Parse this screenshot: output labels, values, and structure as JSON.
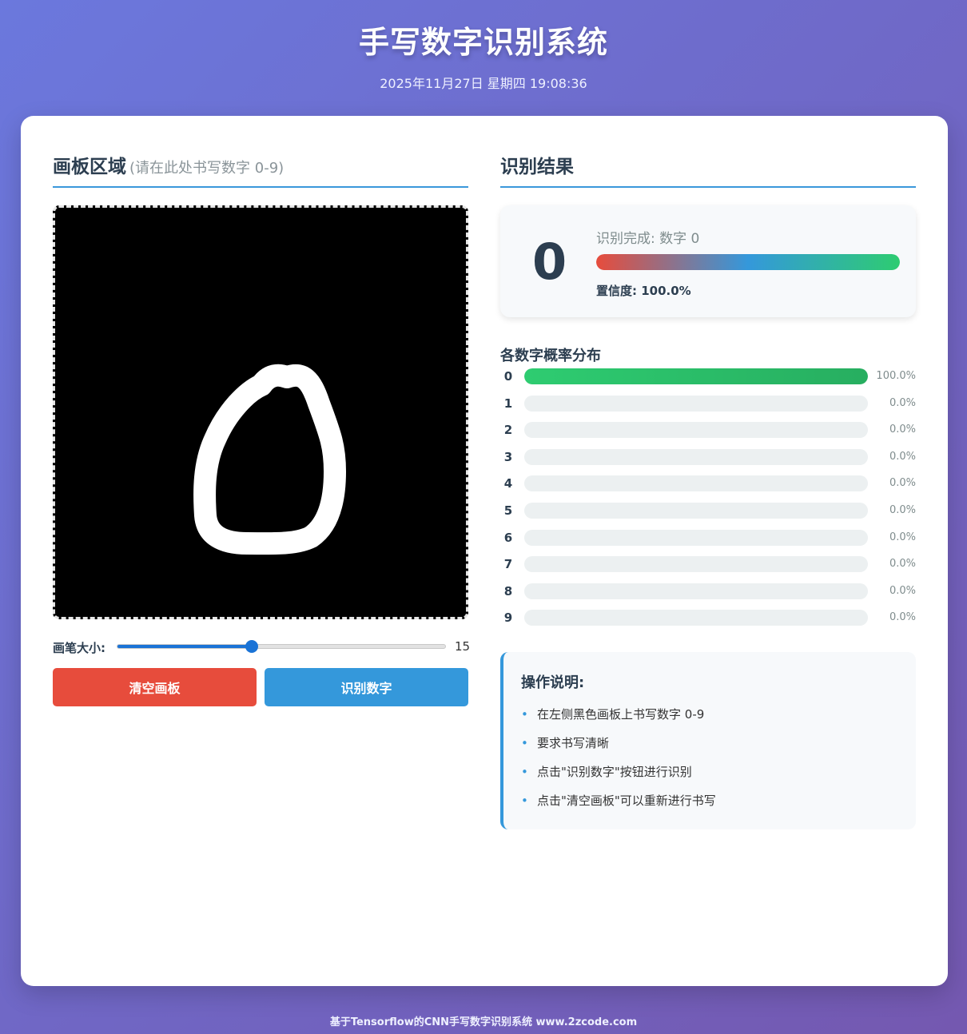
{
  "header": {
    "title": "手写数字识别系统",
    "datetime": "2025年11月27日 星期四 19:08:36"
  },
  "canvas_section": {
    "title": "画板区域",
    "hint": "(请在此处书写数字 0-9)",
    "brush_label": "画笔大小:",
    "brush_value": "15",
    "brush_fraction": 0.41,
    "clear_label": "清空画板",
    "recognize_label": "识别数字"
  },
  "result_section": {
    "title": "识别结果",
    "digit": "0",
    "status": "识别完成: 数字 0",
    "confidence_text": "置信度: 100.0%",
    "confidence_fraction": 1.0
  },
  "probability": {
    "title": "各数字概率分布",
    "rows": [
      {
        "digit": "0",
        "value": "100.0%",
        "fraction": 1.0
      },
      {
        "digit": "1",
        "value": "0.0%",
        "fraction": 0
      },
      {
        "digit": "2",
        "value": "0.0%",
        "fraction": 0
      },
      {
        "digit": "3",
        "value": "0.0%",
        "fraction": 0
      },
      {
        "digit": "4",
        "value": "0.0%",
        "fraction": 0
      },
      {
        "digit": "5",
        "value": "0.0%",
        "fraction": 0
      },
      {
        "digit": "6",
        "value": "0.0%",
        "fraction": 0
      },
      {
        "digit": "7",
        "value": "0.0%",
        "fraction": 0
      },
      {
        "digit": "8",
        "value": "0.0%",
        "fraction": 0
      },
      {
        "digit": "9",
        "value": "0.0%",
        "fraction": 0
      }
    ]
  },
  "instructions": {
    "title": "操作说明:",
    "items": [
      "在左侧黑色画板上书写数字 0-9",
      "要求书写清晰",
      "点击\"识别数字\"按钮进行识别",
      "点击\"清空画板\"可以重新进行书写"
    ]
  },
  "footer": "基于Tensorflow的CNN手写数字识别系统 www.2zcode.com",
  "colors": {
    "accent": "#3498db",
    "danger": "#e74c3c",
    "success": "#2ecc71"
  }
}
